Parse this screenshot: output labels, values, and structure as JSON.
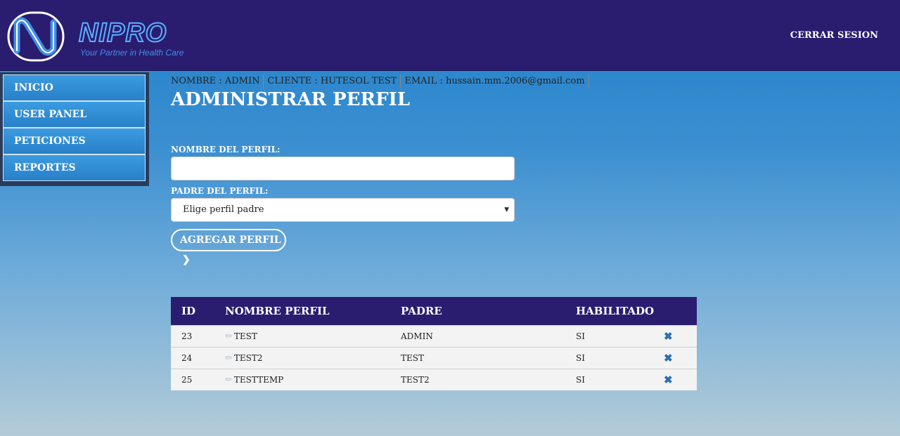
{
  "header": {
    "logo_text": "NIPRO",
    "tagline": "Your Partner in Health Care",
    "logout_label": "CERRAR SESION"
  },
  "sidebar": {
    "items": [
      {
        "label": "INICIO"
      },
      {
        "label": "USER PANEL"
      },
      {
        "label": "PETICIONES"
      },
      {
        "label": "REPORTES"
      }
    ]
  },
  "info": {
    "name": "NOMBRE : ADMIN",
    "client": "CLIENTE : HUTESOL TEST",
    "email": "EMAIL : hussain.mm.2006@gmail.com"
  },
  "page": {
    "title": "ADMINISTRAR PERFIL"
  },
  "form": {
    "name_label": "NOMBRE DEL PERFIL:",
    "name_value": "",
    "parent_label": "PADRE DEL PERFIL:",
    "parent_selected": "Elige perfil padre",
    "add_label": "AGREGAR PERFIL"
  },
  "table": {
    "headers": [
      "ID",
      "NOMBRE PERFIL",
      "PADRE",
      "HABILITADO"
    ],
    "rows": [
      {
        "id": "23",
        "name": "TEST",
        "parent": "ADMIN",
        "enabled": "SI"
      },
      {
        "id": "24",
        "name": "TEST2",
        "parent": "TEST",
        "enabled": "SI"
      },
      {
        "id": "25",
        "name": "TESTTEMP",
        "parent": "TEST2",
        "enabled": "SI"
      }
    ]
  },
  "colors": {
    "header_bg": "#2a1d70",
    "nav_bg": "#2880c8",
    "delete_icon": "#2a6fb0"
  },
  "icons": {
    "edit": "pencil-icon",
    "delete": "close-icon",
    "caret": "chevron-down-icon",
    "add": "chevron-right-icon"
  }
}
